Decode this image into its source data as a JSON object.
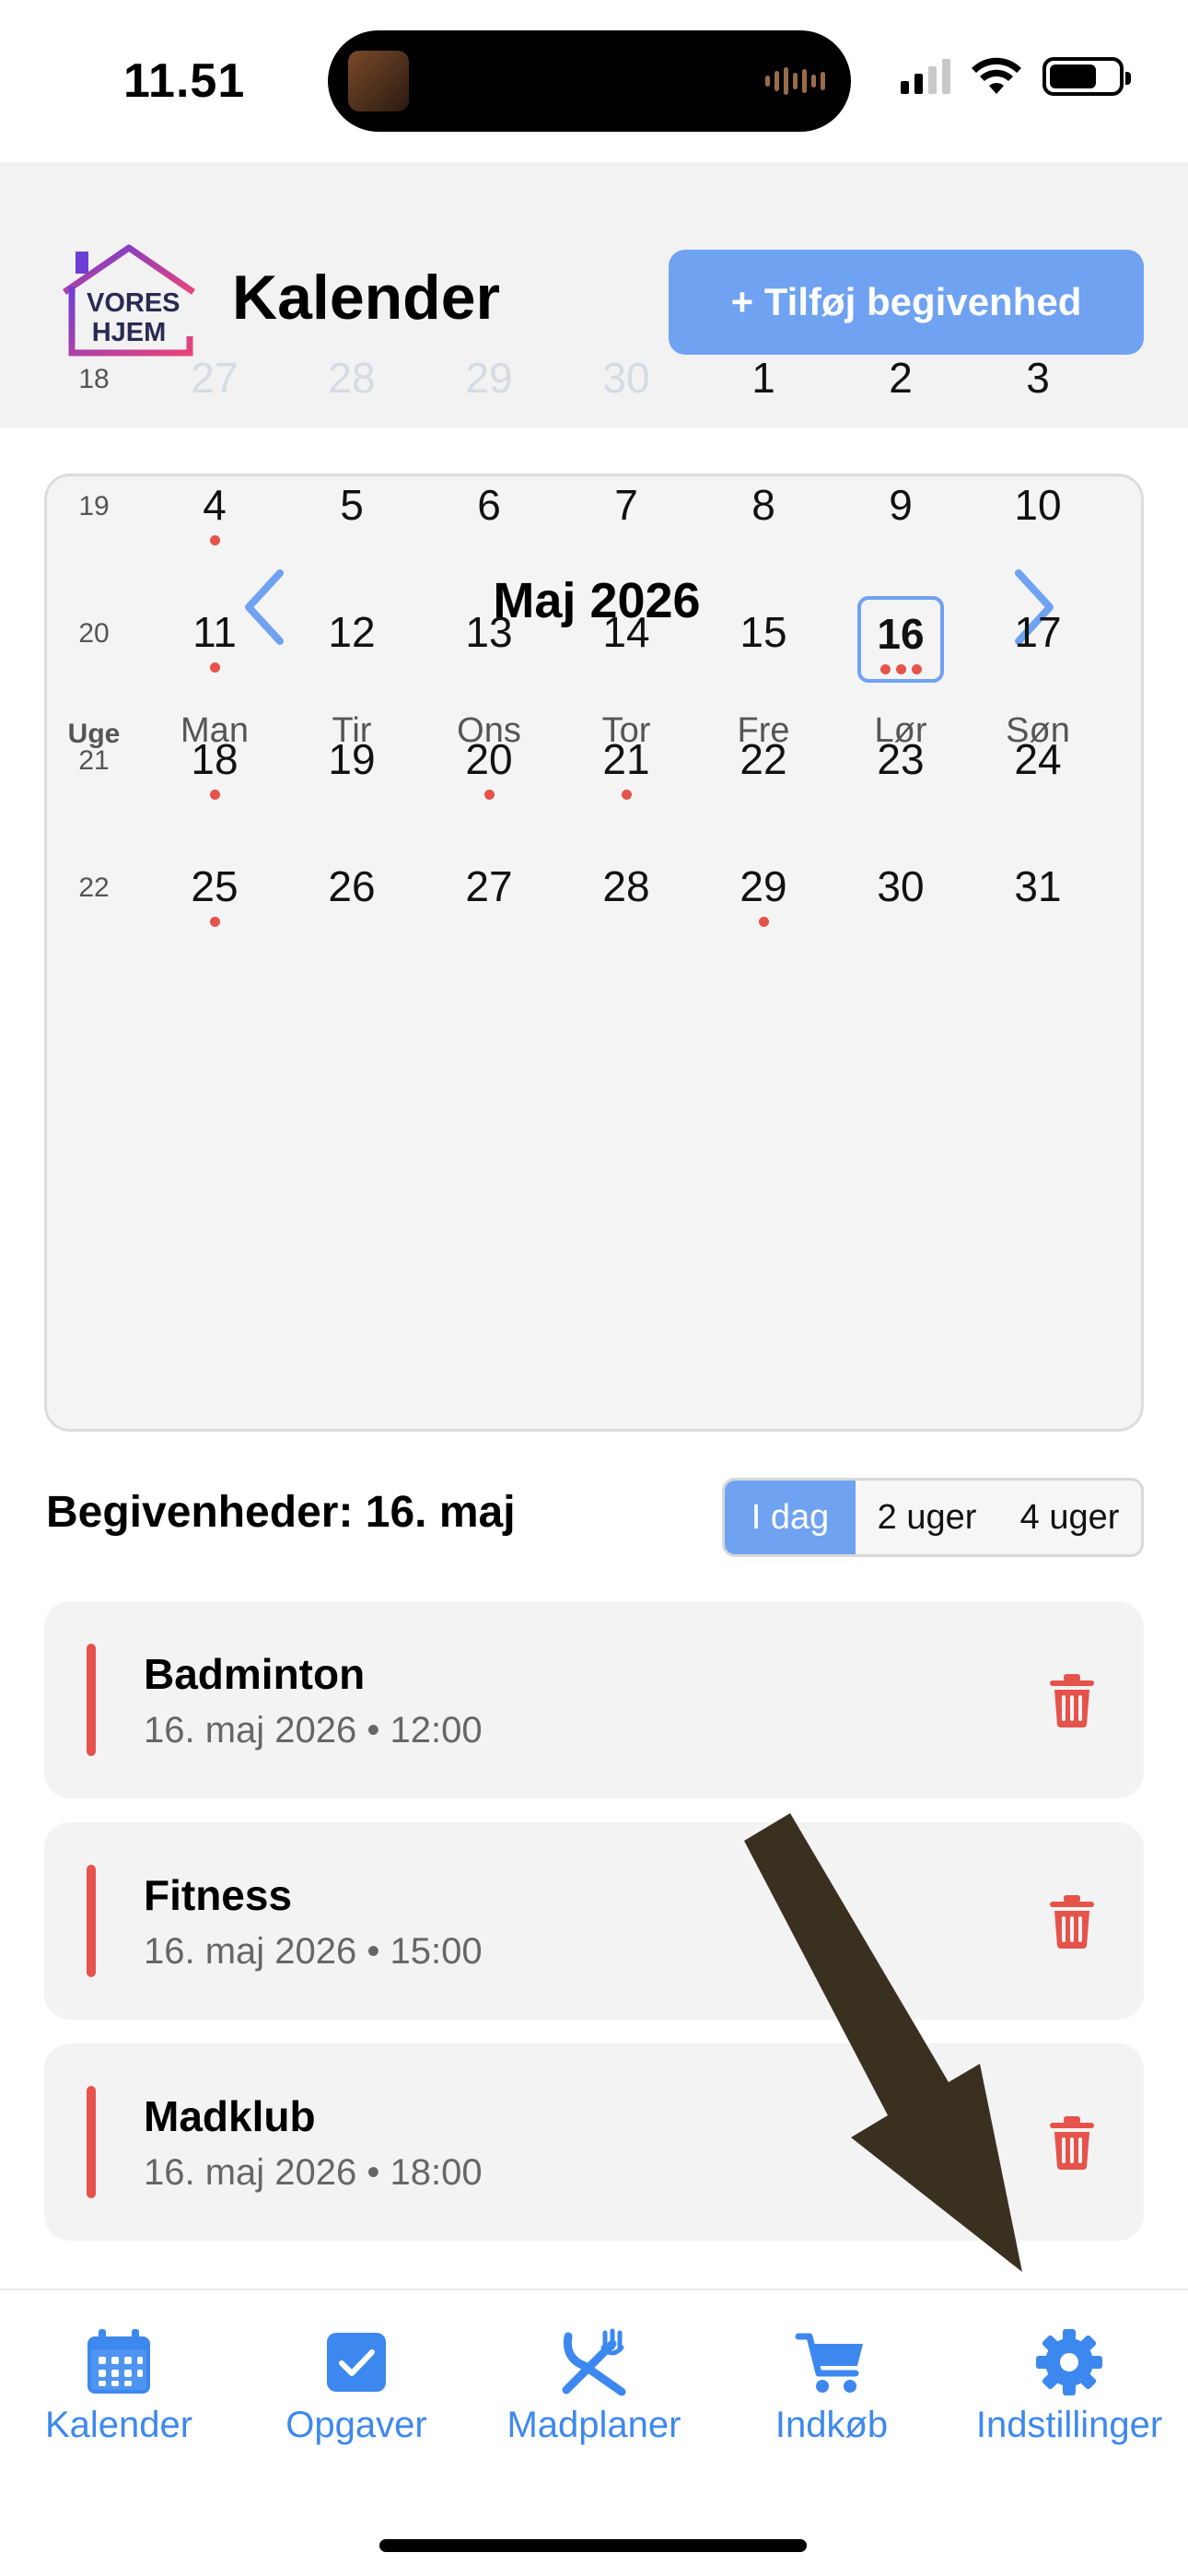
{
  "status_bar": {
    "time": "11.51"
  },
  "header": {
    "logo_line1": "VORES",
    "logo_line2": "HJEM",
    "title": "Kalender",
    "add_button": "+ Tilføj begivenhed"
  },
  "calendar": {
    "month_title": "Maj 2026",
    "week_header": "Uge",
    "weekdays": [
      "Man",
      "Tir",
      "Ons",
      "Tor",
      "Fre",
      "Lør",
      "Søn"
    ],
    "weeks": [
      {
        "num": "18",
        "days": [
          {
            "d": "27",
            "muted": true,
            "dots": 0
          },
          {
            "d": "28",
            "muted": true,
            "dots": 0
          },
          {
            "d": "29",
            "muted": true,
            "dots": 0
          },
          {
            "d": "30",
            "muted": true,
            "dots": 0
          },
          {
            "d": "1",
            "dots": 0
          },
          {
            "d": "2",
            "dots": 0
          },
          {
            "d": "3",
            "dots": 0
          }
        ]
      },
      {
        "num": "19",
        "days": [
          {
            "d": "4",
            "dots": 1
          },
          {
            "d": "5",
            "dots": 0
          },
          {
            "d": "6",
            "dots": 0
          },
          {
            "d": "7",
            "dots": 0
          },
          {
            "d": "8",
            "dots": 0
          },
          {
            "d": "9",
            "dots": 0
          },
          {
            "d": "10",
            "dots": 0
          }
        ]
      },
      {
        "num": "20",
        "days": [
          {
            "d": "11",
            "dots": 1
          },
          {
            "d": "12",
            "dots": 0
          },
          {
            "d": "13",
            "dots": 0
          },
          {
            "d": "14",
            "dots": 0
          },
          {
            "d": "15",
            "dots": 0
          },
          {
            "d": "16",
            "dots": 3,
            "today": true
          },
          {
            "d": "17",
            "dots": 0
          }
        ]
      },
      {
        "num": "21",
        "days": [
          {
            "d": "18",
            "dots": 1
          },
          {
            "d": "19",
            "dots": 0
          },
          {
            "d": "20",
            "dots": 1
          },
          {
            "d": "21",
            "dots": 1
          },
          {
            "d": "22",
            "dots": 0
          },
          {
            "d": "23",
            "dots": 0
          },
          {
            "d": "24",
            "dots": 0
          }
        ]
      },
      {
        "num": "22",
        "days": [
          {
            "d": "25",
            "dots": 1
          },
          {
            "d": "26",
            "dots": 0
          },
          {
            "d": "27",
            "dots": 0
          },
          {
            "d": "28",
            "dots": 0
          },
          {
            "d": "29",
            "dots": 1
          },
          {
            "d": "30",
            "dots": 0
          },
          {
            "d": "31",
            "dots": 0
          }
        ]
      }
    ]
  },
  "events_section": {
    "heading": "Begivenheder: 16. maj",
    "range_options": [
      "I dag",
      "2 uger",
      "4 uger"
    ],
    "selected_range": "I dag"
  },
  "events": [
    {
      "title": "Badminton",
      "meta": "16. maj 2026 • 12:00"
    },
    {
      "title": "Fitness",
      "meta": "16. maj 2026 • 15:00"
    },
    {
      "title": "Madklub",
      "meta": "16. maj 2026 • 18:00"
    }
  ],
  "tab_bar": [
    {
      "label": "Kalender",
      "icon": "calendar-icon"
    },
    {
      "label": "Opgaver",
      "icon": "checkbox-icon"
    },
    {
      "label": "Madplaner",
      "icon": "utensils-icon"
    },
    {
      "label": "Indkøb",
      "icon": "cart-icon"
    },
    {
      "label": "Indstillinger",
      "icon": "gear-icon"
    }
  ],
  "colors": {
    "accent": "#6fa2f1",
    "tab_blue": "#3d88ee",
    "event_red": "#e5534b",
    "annotation_arrow": "#3a3020"
  }
}
